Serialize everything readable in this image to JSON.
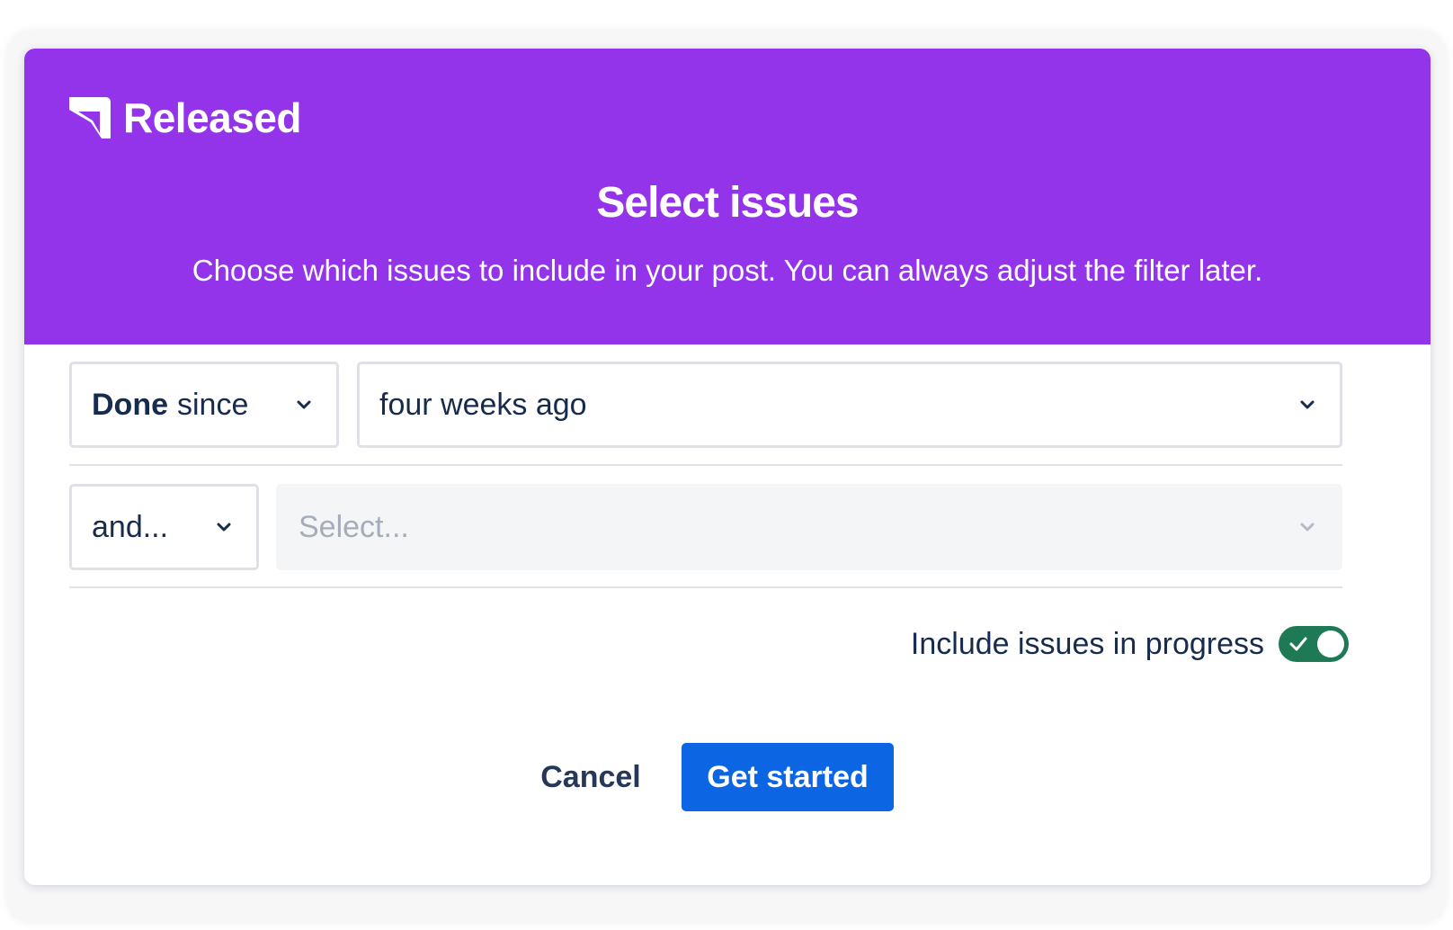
{
  "brand": {
    "name": "Released",
    "color": "#9333ea",
    "logo_icon": "released-logo-icon"
  },
  "dialog": {
    "title": "Select issues",
    "subtitle": "Choose which issues to include in your post. You can always adjust the filter later."
  },
  "filters": {
    "status": {
      "strong": "Done",
      "rest": "since"
    },
    "time": {
      "value": "four weeks ago"
    },
    "conjunction": {
      "value": "and..."
    },
    "field": {
      "placeholder": "Select...",
      "disabled": true
    }
  },
  "in_progress": {
    "label": "Include issues in progress",
    "checked": true,
    "color": "#1e7a55"
  },
  "actions": {
    "cancel": "Cancel",
    "primary": "Get started",
    "primary_color": "#0c66e4"
  }
}
